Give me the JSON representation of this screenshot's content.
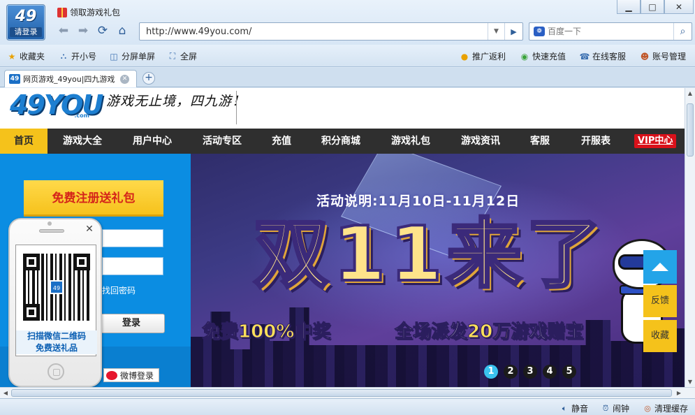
{
  "app": {
    "logo_number": "49",
    "login_label": "请登录",
    "window_title": "领取游戏礼包"
  },
  "window_controls": {
    "minimize": "▁",
    "maximize": "□",
    "close": "✕"
  },
  "address": {
    "url": "http://www.49you.com/"
  },
  "search": {
    "placeholder": "百度一下"
  },
  "toolbar": {
    "left": [
      {
        "label": "收藏夹",
        "icon": "star-icon"
      },
      {
        "label": "开小号",
        "icon": "multi-user-icon"
      },
      {
        "label": "分屏单屏",
        "icon": "split-screen-icon"
      },
      {
        "label": "全屏",
        "icon": "fullscreen-icon"
      }
    ],
    "right": [
      {
        "label": "推广返利",
        "icon": "coin-icon"
      },
      {
        "label": "快速充值",
        "icon": "recharge-icon"
      },
      {
        "label": "在线客服",
        "icon": "phone-icon"
      },
      {
        "label": "账号管理",
        "icon": "account-icon"
      }
    ]
  },
  "tab": {
    "favicon": "49",
    "title": "网页游戏_49you|四九游戏"
  },
  "site": {
    "logo": "49YOU",
    "logo_suffix": ".com",
    "slogan": "游戏无止境，四九游！",
    "nav": [
      "首页",
      "游戏大全",
      "用户中心",
      "活动专区",
      "充值",
      "积分商城",
      "游戏礼包",
      "游戏资讯",
      "客服",
      "开服表"
    ],
    "nav_vip": "VIP中心"
  },
  "login": {
    "register_button": "免费注册送礼包",
    "forgot_link": "找回密码",
    "login_button": "登录",
    "weibo_button": "微博登录"
  },
  "qr_popup": {
    "caption_line1": "扫描微信二维码",
    "caption_line2": "免费送礼品",
    "close": "✕"
  },
  "banner": {
    "activity": "活动说明:11月10日-11月12日",
    "title": "双11来了",
    "sub_left_prefix": "免费",
    "sub_left_highlight": "100%",
    "sub_left_suffix": "中奖",
    "sub_right_prefix": "全场派发",
    "sub_right_highlight": "20万",
    "sub_right_suffix": "游戏赠宝",
    "pages": [
      "1",
      "2",
      "3",
      "4",
      "5"
    ],
    "active_page": 1
  },
  "side": {
    "feedback": "反馈",
    "favorite": "收藏"
  },
  "status": [
    {
      "label": "静音",
      "icon": "speaker-icon"
    },
    {
      "label": "闹钟",
      "icon": "alarm-icon"
    },
    {
      "label": "清理缓存",
      "icon": "clean-icon"
    }
  ],
  "colors": {
    "nav_active": "#f5c21b",
    "vip": "#d9111a",
    "login_panel": "#0b8de2",
    "accent_blue": "#23a4e8"
  }
}
